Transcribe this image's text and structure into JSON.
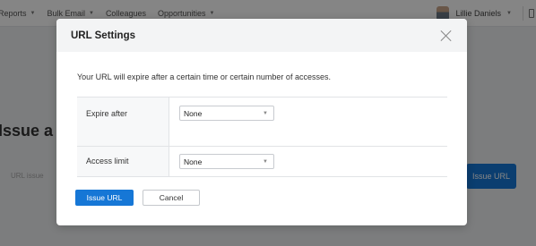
{
  "topnav": {
    "items": [
      {
        "label": "Reports"
      },
      {
        "label": "Bulk Email"
      },
      {
        "label": "Colleagues"
      },
      {
        "label": "Opportunities"
      }
    ],
    "caret": "▼",
    "user_name": "Lillie Daniels",
    "user_caret": "▼"
  },
  "background": {
    "heading": "Issue a",
    "url_label": "URL issue",
    "issue_button": "Issue URL"
  },
  "modal": {
    "title": "URL Settings",
    "description": "Your URL will expire after a certain time or certain number of accesses.",
    "rows": [
      {
        "label": "Expire after",
        "value": "None"
      },
      {
        "label": "Access limit",
        "value": "None"
      }
    ],
    "select_caret": "▼",
    "primary_button": "Issue URL",
    "cancel_button": "Cancel"
  },
  "colors": {
    "primary": "#1677d6",
    "overlay": "rgba(0,0,0,0.48)",
    "header_bg": "#f3f4f5"
  }
}
